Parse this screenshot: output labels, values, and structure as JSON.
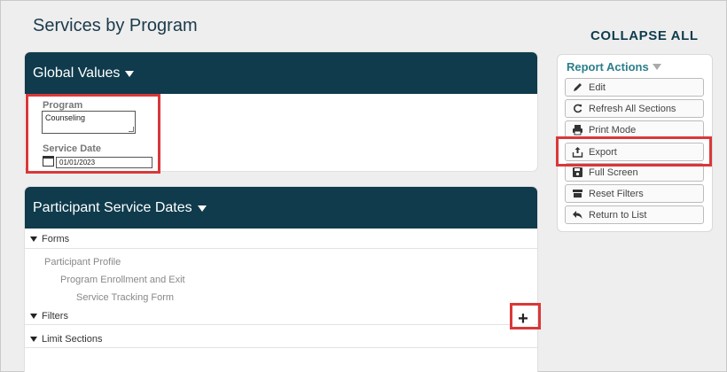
{
  "page": {
    "title": "Services by Program",
    "collapse_all": "COLLAPSE ALL"
  },
  "global_values": {
    "header": "Global Values",
    "program_label": "Program",
    "program_value": "Counseling",
    "service_date_label": "Service Date",
    "service_date_value": "01/01/2023"
  },
  "participant_service_dates": {
    "header": "Participant Service Dates",
    "forms_label": "Forms",
    "forms": [
      "Participant Profile",
      "Program Enrollment and Exit",
      "Service Tracking Form"
    ],
    "filters_label": "Filters",
    "limit_sections_label": "Limit Sections",
    "add_filter_symbol": "+"
  },
  "report_actions": {
    "title": "Report Actions",
    "buttons": [
      {
        "label": "Edit",
        "icon": "pencil-icon"
      },
      {
        "label": "Refresh All Sections",
        "icon": "refresh-icon"
      },
      {
        "label": "Print Mode",
        "icon": "print-icon"
      },
      {
        "label": "Export",
        "icon": "export-icon"
      },
      {
        "label": "Full Screen",
        "icon": "save-icon"
      },
      {
        "label": "Reset Filters",
        "icon": "reset-filters-icon"
      },
      {
        "label": "Return to List",
        "icon": "return-icon"
      }
    ]
  },
  "colors": {
    "header_bg": "#0f3b4c",
    "accent_teal": "#2b7e8c",
    "highlight_red": "#d9383a"
  }
}
